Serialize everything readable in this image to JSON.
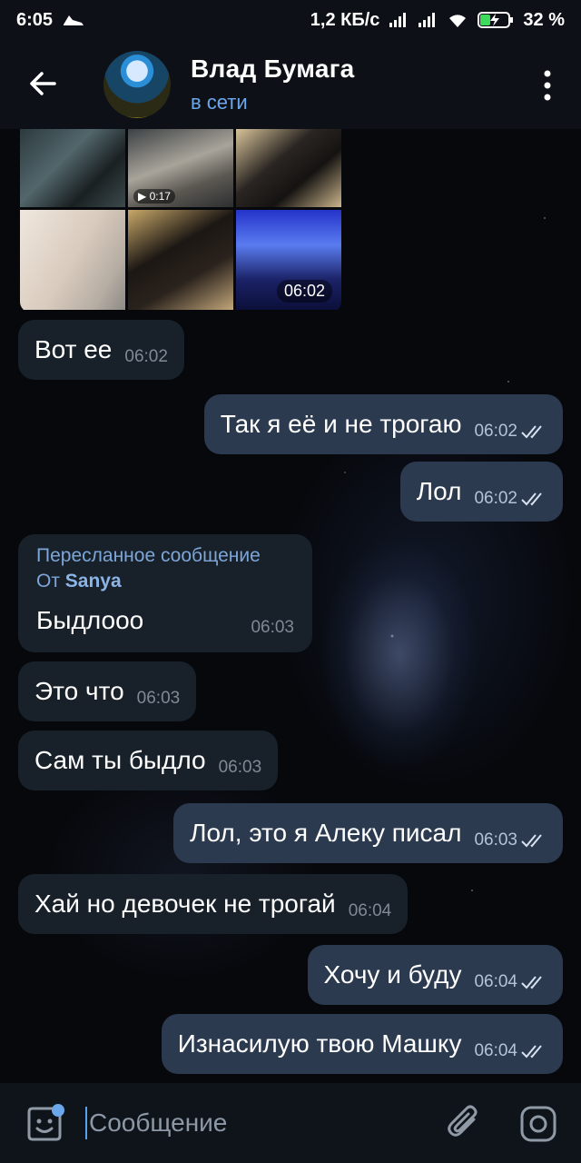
{
  "status_bar": {
    "time": "6:05",
    "network_speed": "1,2 КБ/с",
    "battery": "32 %"
  },
  "header": {
    "contact_name": "Влад Бумага",
    "status": "в сети",
    "back_icon": "arrow-left-icon",
    "menu_icon": "more-vertical-icon"
  },
  "media_group": {
    "video_duration": "0:17",
    "time": "06:02"
  },
  "messages": [
    {
      "direction": "in",
      "text": "Вот ее",
      "time": "06:02"
    },
    {
      "direction": "out",
      "text": "Так я её и не трогаю",
      "time": "06:02",
      "read": true
    },
    {
      "direction": "out",
      "text": "Лол",
      "time": "06:02",
      "read": true
    },
    {
      "direction": "in",
      "forwarded_label": "Пересланное сообщение",
      "forwarded_from_prefix": "От",
      "forwarded_from": "Sanya",
      "text": "Быдлооо",
      "time": "06:03"
    },
    {
      "direction": "in",
      "text": "Это что",
      "time": "06:03"
    },
    {
      "direction": "in",
      "text": "Сам ты быдло",
      "time": "06:03"
    },
    {
      "direction": "out",
      "text": "Лол, это я Алеку писал",
      "time": "06:03",
      "read": true
    },
    {
      "direction": "in",
      "text": "Хай но девочек не трогай",
      "time": "06:04"
    },
    {
      "direction": "out",
      "text": "Хочу и буду",
      "time": "06:04",
      "read": true
    },
    {
      "direction": "out",
      "text": "Изнасилую твою Машку",
      "time": "06:04",
      "read": true
    }
  ],
  "input": {
    "placeholder": "Сообщение"
  },
  "colors": {
    "accent": "#6ba7ea",
    "incoming_bubble": "#182029",
    "outgoing_bubble": "#2b3a4f"
  }
}
